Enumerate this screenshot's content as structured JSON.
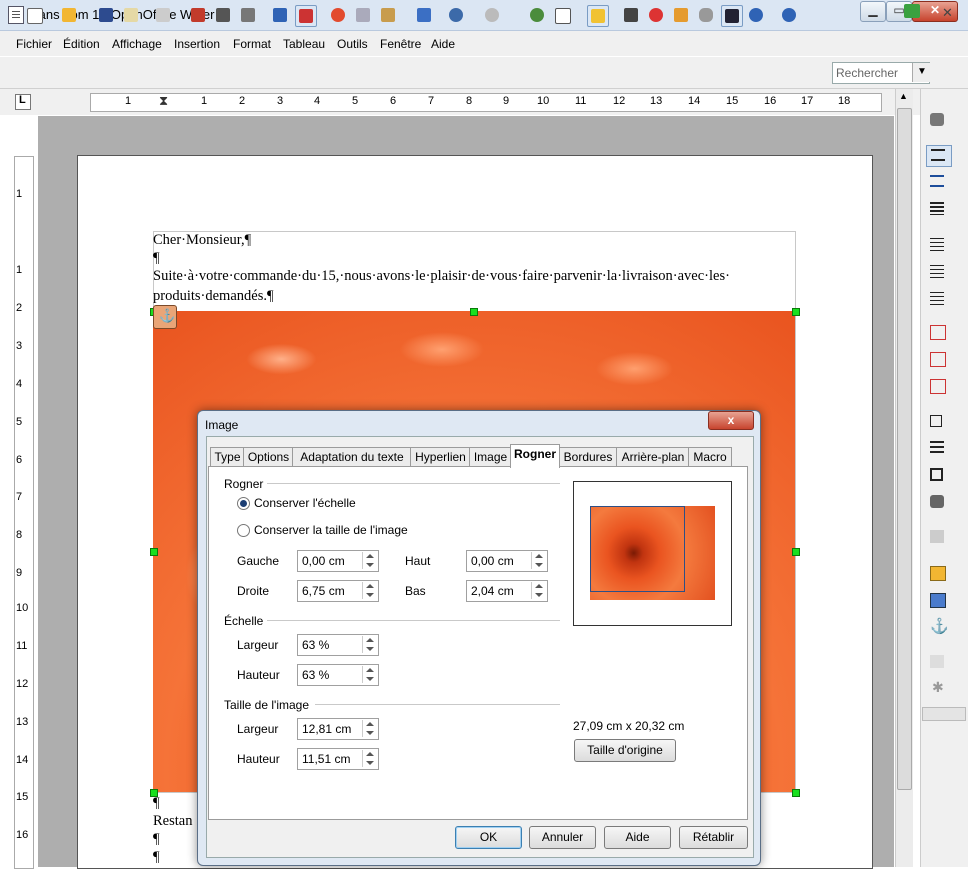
{
  "window": {
    "title": "Sans nom 1 - OpenOffice Writer"
  },
  "menu": [
    "Fichier",
    "Édition",
    "Affichage",
    "Insertion",
    "Format",
    "Tableau",
    "Outils",
    "Fenêtre",
    "Aide"
  ],
  "toolbar": {
    "search_placeholder": "Rechercher"
  },
  "ruler": {
    "h_numbers": [
      "1",
      "1",
      "2",
      "3",
      "4",
      "5",
      "6",
      "7",
      "8",
      "9",
      "10",
      "11",
      "12",
      "13",
      "14",
      "15",
      "16",
      "17",
      "18"
    ],
    "v_numbers": [
      "1",
      "1",
      "2",
      "3",
      "4",
      "5",
      "6",
      "7",
      "8",
      "9",
      "10",
      "11",
      "12",
      "13",
      "14",
      "15",
      "16"
    ]
  },
  "document": {
    "lines": [
      "Cher·Monsieur,¶",
      "¶",
      "Suite·à·votre·commande·du·15,·nous·avons·le·plaisir·de·vous·faire·parvenir·la·livraison·avec·les·",
      "produits·demandés.¶"
    ],
    "after_image": [
      "¶",
      "Restan",
      "¶",
      "¶"
    ]
  },
  "dialog": {
    "title": "Image",
    "close": "x",
    "tabs": [
      "Type",
      "Options",
      "Adaptation du texte",
      "Hyperlien",
      "Image",
      "Rogner",
      "Bordures",
      "Arrière-plan",
      "Macro"
    ],
    "active_tab": "Rogner",
    "crop": {
      "group": "Rogner",
      "keep_scale": "Conserver l'échelle",
      "keep_size": "Conserver la taille de l'image",
      "left_label": "Gauche",
      "left_value": "0,00 cm",
      "top_label": "Haut",
      "top_value": "0,00 cm",
      "right_label": "Droite",
      "right_value": "6,75 cm",
      "bottom_label": "Bas",
      "bottom_value": "2,04 cm"
    },
    "scale": {
      "group": "Échelle",
      "width_label": "Largeur",
      "width_value": "63 %",
      "height_label": "Hauteur",
      "height_value": "63 %"
    },
    "size": {
      "group": "Taille de l'image",
      "width_label": "Largeur",
      "width_value": "12,81 cm",
      "height_label": "Hauteur",
      "height_value": "11,51 cm"
    },
    "original_size": "27,09 cm x 20,32 cm",
    "original_size_button": "Taille d'origine",
    "buttons": {
      "ok": "OK",
      "cancel": "Annuler",
      "help": "Aide",
      "reset": "Rétablir"
    }
  },
  "colors": {
    "accent": "#3c7fb1",
    "image_orange": "#f06a2e",
    "handle_green": "#19e01e"
  }
}
